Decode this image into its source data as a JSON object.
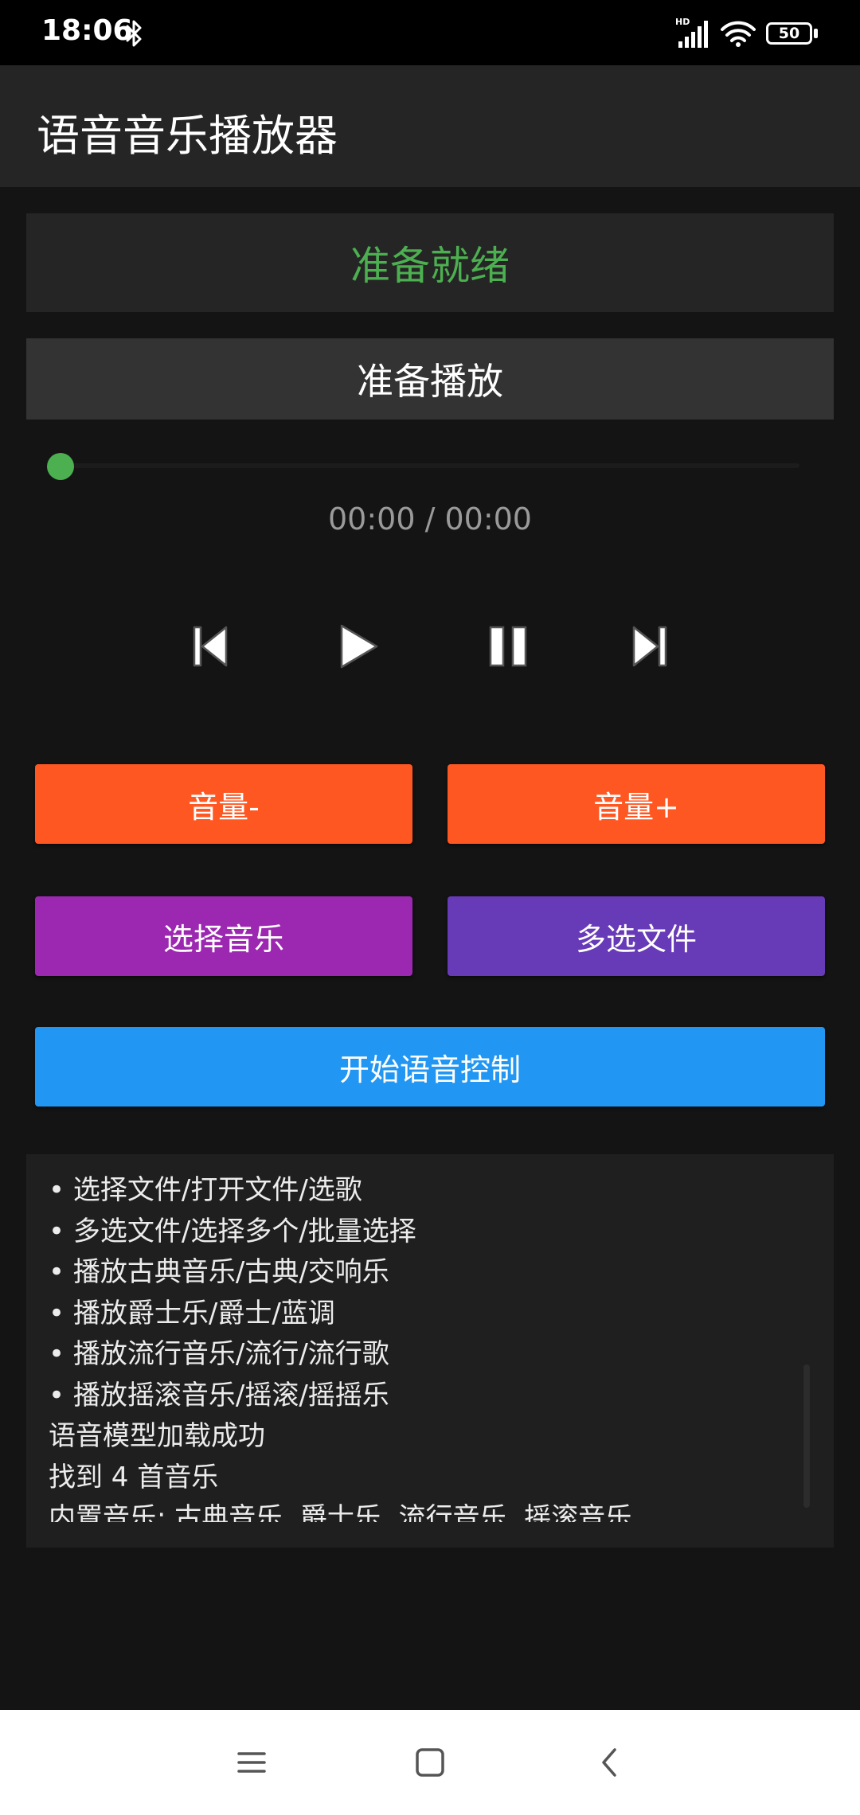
{
  "status_bar": {
    "time": "18:06",
    "battery": "50",
    "network_badge": "HD",
    "icons": [
      "bluetooth-icon",
      "signal-icon",
      "wifi-icon",
      "battery-icon"
    ]
  },
  "app": {
    "title": "语音音乐播放器"
  },
  "player": {
    "status_text": "准备就绪",
    "track_text": "准备播放",
    "progress": 0,
    "time_display": "00:00 / 00:00",
    "controls": [
      "previous-icon",
      "play-icon",
      "pause-icon",
      "next-icon"
    ]
  },
  "buttons": {
    "volume_down": "音量-",
    "volume_up": "音量+",
    "select_music": "选择音乐",
    "multi_select": "多选文件",
    "voice_control": "开始语音控制"
  },
  "log": {
    "lines": [
      "• 选择文件/打开文件/选歌",
      "• 多选文件/选择多个/批量选择",
      "• 播放古典音乐/古典/交响乐",
      "• 播放爵士乐/爵士/蓝调",
      "• 播放流行音乐/流行/流行歌",
      "• 播放摇滚音乐/摇滚/摇摇乐",
      "语音模型加载成功",
      "找到 4 首音乐",
      "内置音乐: 古典音乐, 爵士乐, 流行音乐, 摇滚音乐"
    ]
  },
  "colors": {
    "ready_green": "#4caf50",
    "volume_orange": "#ff5722",
    "select_purple": "#9c27b0",
    "multi_deep_purple": "#673ab7",
    "voice_blue": "#2196f3",
    "background": "#141414"
  },
  "navigation": {
    "icons": [
      "menu-icon",
      "home-icon",
      "back-icon"
    ]
  }
}
